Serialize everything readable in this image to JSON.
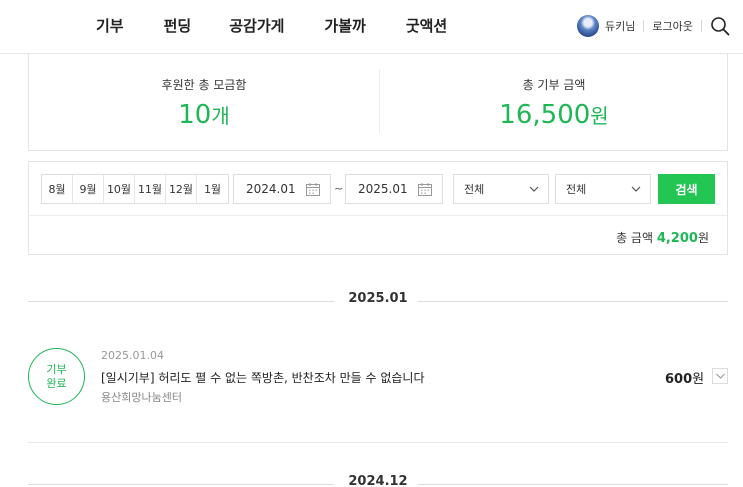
{
  "nav": [
    "기부",
    "펀딩",
    "공감가게",
    "가볼까",
    "굿액션"
  ],
  "user": {
    "name": "듀키님",
    "logout": "로그아웃"
  },
  "summary": {
    "supported_label": "후원한 총 모금함",
    "supported_value": "10",
    "supported_unit": "개",
    "donation_label": "총 기부 금액",
    "donation_value": "16,500",
    "donation_unit": "원"
  },
  "filter": {
    "months": [
      "8월",
      "9월",
      "10월",
      "11월",
      "12월",
      "1월"
    ],
    "date_from": "2024.01",
    "tilde": "~",
    "date_to": "2025.01",
    "select1": "전체",
    "select2": "전체",
    "search_label": "검색",
    "total_label": "총 금액",
    "total_value": "4,200",
    "total_unit": "원"
  },
  "timeline": {
    "month_label": "2025.01",
    "next_month_label": "2024.12",
    "items": [
      {
        "badge_line1": "기부",
        "badge_line2": "완료",
        "date": "2025.01.04",
        "title": "[일시기부] 허리도 펼 수 없는 쪽방촌, 반찬조차 만들 수 없습니다",
        "org": "용산희망나눔센터",
        "amount": "600",
        "unit": "원"
      }
    ]
  },
  "colors": {
    "accent": "#1fb655",
    "button": "#23c553"
  }
}
